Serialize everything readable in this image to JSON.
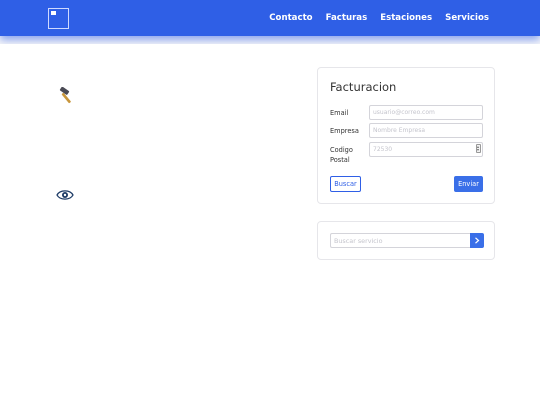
{
  "nav": {
    "links": [
      "Contacto",
      "Facturas",
      "Estaciones",
      "Servicios"
    ]
  },
  "icons": {
    "tool": "hammer-icon",
    "view": "eye-icon",
    "submit_search": "chevron-right-icon"
  },
  "billing": {
    "title": "Facturacion",
    "email_label": "Email",
    "email_placeholder": "usuario@correo.com",
    "company_label": "Empresa",
    "company_placeholder": "Nombre Empresa",
    "postal_label_line1": "Codigo",
    "postal_label_line2": "Postal",
    "postal_placeholder": "72530",
    "search_button": "Buscar",
    "submit_button": "Enviar"
  },
  "search": {
    "placeholder": "Buscar servicio"
  },
  "colors": {
    "brand": "#2f5fe6",
    "button_primary": "#3a6fe8",
    "text": "#333333",
    "border": "#e6e6ea"
  }
}
